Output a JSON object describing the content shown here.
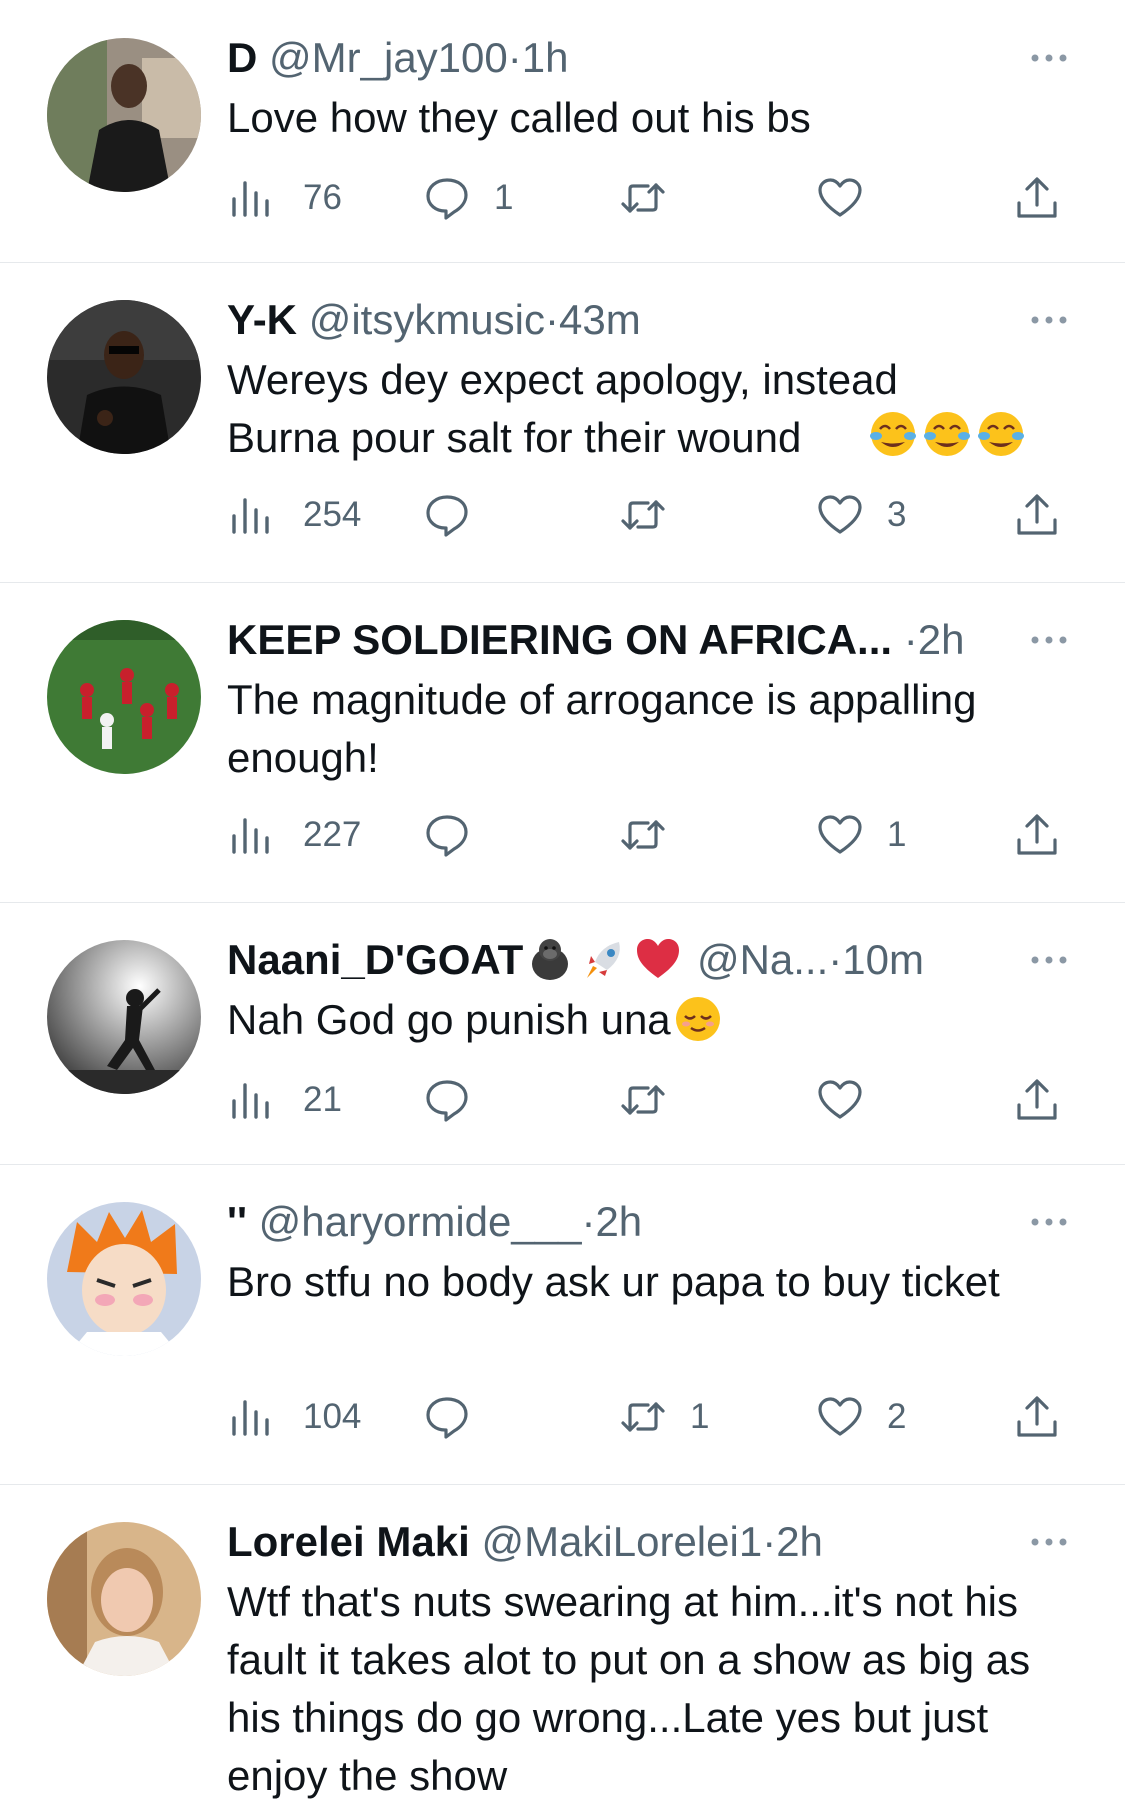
{
  "tweets": [
    {
      "display_name": "D",
      "handle": "@Mr_jay100",
      "separator": "·",
      "time": "1h",
      "text": "Love how they called out his bs",
      "name_emojis": [],
      "text_emojis": [],
      "views": "76",
      "replies": "1",
      "retweets": "",
      "likes": ""
    },
    {
      "display_name": "Y-K",
      "handle": "@itsykmusic",
      "separator": "·",
      "time": "43m",
      "text": "Wereys dey expect apology, instead Burna pour salt for their wound",
      "name_emojis": [],
      "text_emojis": [
        "face-with-tears-of-joy-emoji",
        "face-with-tears-of-joy-emoji",
        "face-with-tears-of-joy-emoji"
      ],
      "views": "254",
      "replies": "",
      "retweets": "",
      "likes": "3"
    },
    {
      "display_name": "KEEP SOLDIERING ON AFRICA...",
      "handle": "",
      "separator": "·",
      "time": "2h",
      "text": "The magnitude of arrogance is appalling enough!",
      "name_emojis": [],
      "text_emojis": [],
      "views": "227",
      "replies": "",
      "retweets": "",
      "likes": "1"
    },
    {
      "display_name": "Naani_D'GOAT",
      "handle": "@Na...",
      "separator": "·",
      "time": "10m",
      "text": "Nah God go punish una",
      "name_emojis": [
        "gorilla-emoji",
        "rocket-emoji",
        "red-heart-emoji"
      ],
      "text_emojis": [
        "relieved-face-emoji"
      ],
      "views": "21",
      "replies": "",
      "retweets": "",
      "likes": ""
    },
    {
      "display_name": "''",
      "handle": "@haryormide___",
      "separator": "·",
      "time": "2h",
      "text": "Bro stfu no body ask ur papa to buy ticket",
      "name_emojis": [],
      "text_emojis": [],
      "views": "104",
      "replies": "",
      "retweets": "1",
      "likes": "2"
    },
    {
      "display_name": "Lorelei Maki",
      "handle": "@MakiLorelei1",
      "separator": "·",
      "time": "2h",
      "text": "Wtf that's nuts swearing at him...it's not his fault it takes alot to put on a show as big as his things do go wrong...Late yes but just enjoy the show",
      "name_emojis": [],
      "text_emojis": [],
      "views": "",
      "replies": "",
      "retweets": "",
      "likes": ""
    }
  ],
  "colors": {
    "text_primary": "#0f1419",
    "text_secondary": "#536471",
    "divider": "#e6e9ec",
    "icon_gray": "#536471"
  },
  "icons": {
    "views": "bar-chart-icon",
    "reply": "speech-bubble-icon",
    "retweet": "retweet-arrows-icon",
    "like": "heart-icon",
    "share": "share-upload-icon",
    "more": "more-dots-icon"
  }
}
